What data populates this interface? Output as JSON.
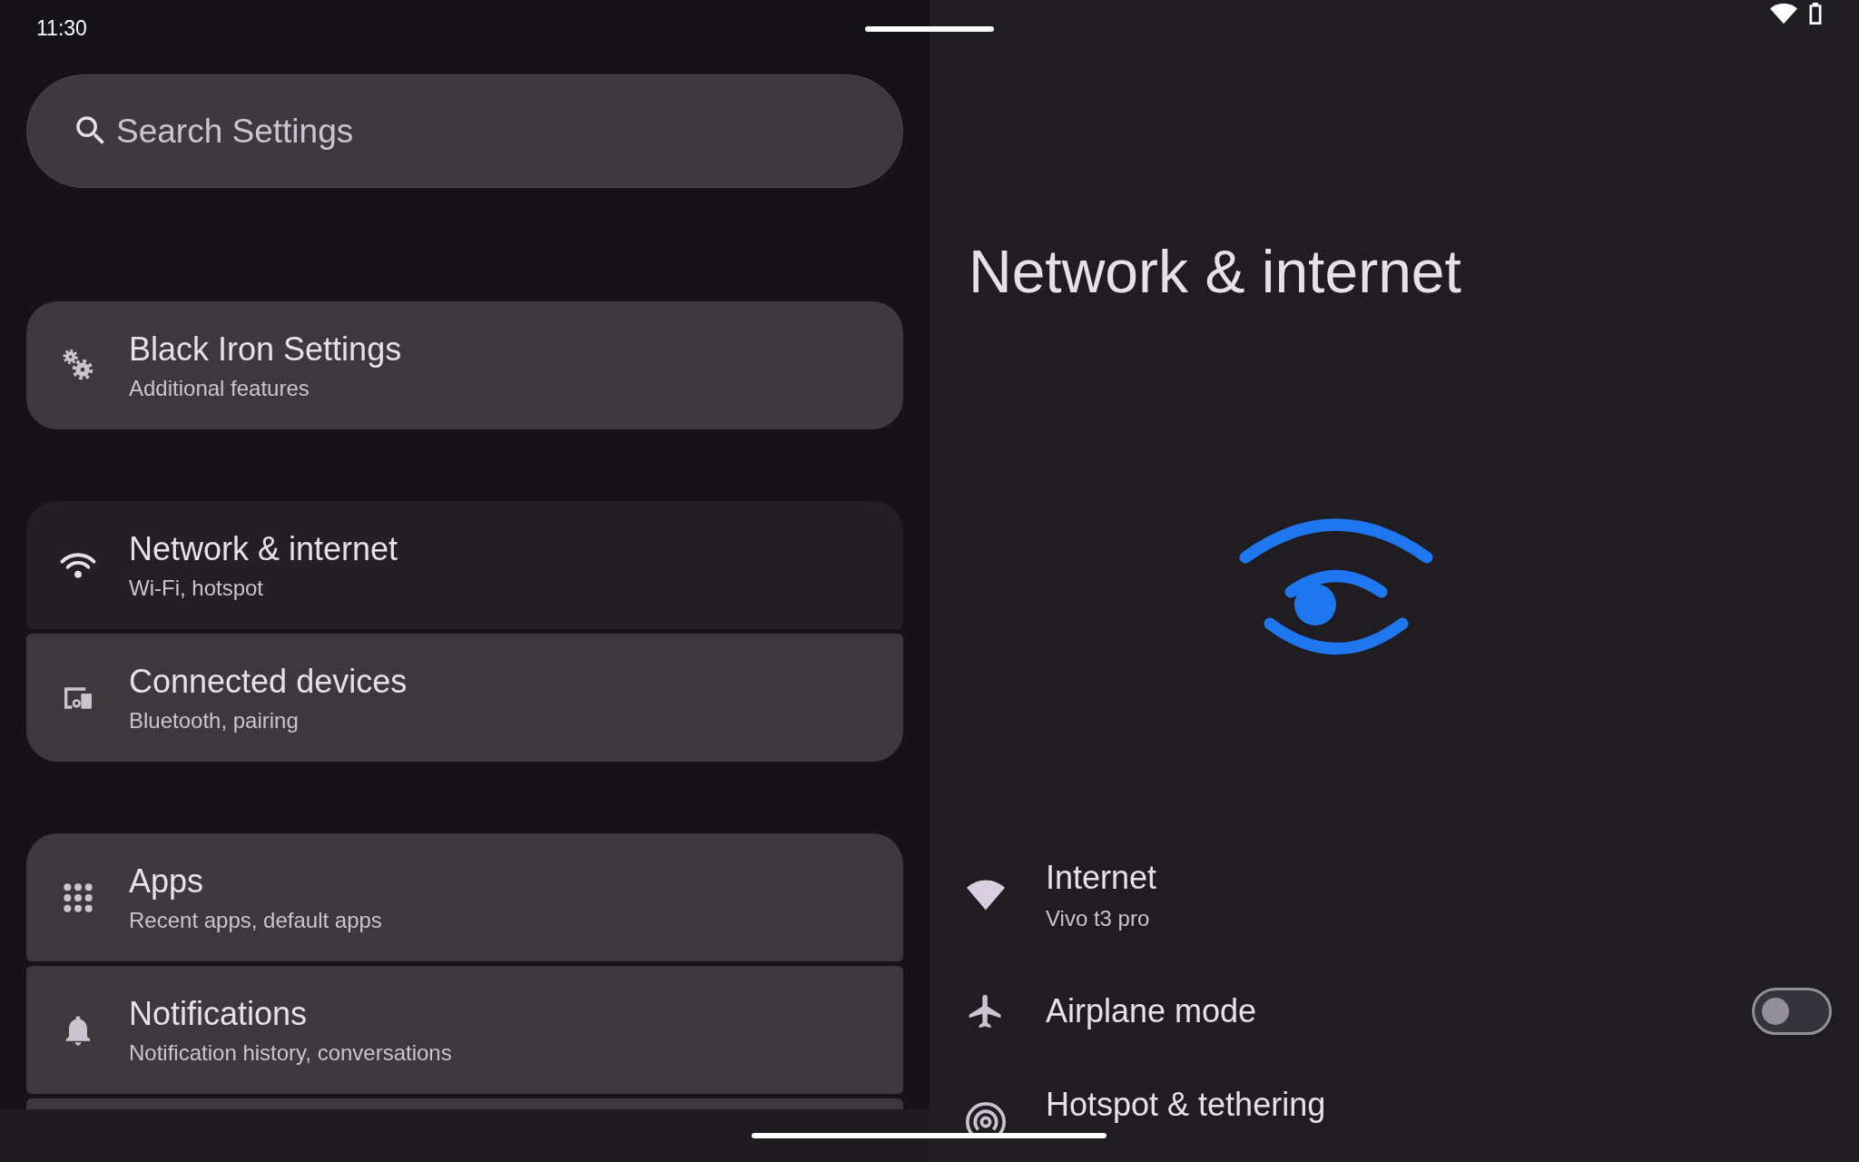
{
  "status_bar": {
    "time": "11:30"
  },
  "search": {
    "placeholder": "Search Settings"
  },
  "groups": [
    {
      "items": [
        {
          "title": "Black Iron Settings",
          "subtitle": "Additional features",
          "selected": false
        }
      ]
    },
    {
      "items": [
        {
          "title": "Network & internet",
          "subtitle": "Wi-Fi, hotspot",
          "selected": true
        },
        {
          "title": "Connected devices",
          "subtitle": "Bluetooth, pairing",
          "selected": false
        }
      ]
    },
    {
      "items": [
        {
          "title": "Apps",
          "subtitle": "Recent apps, default apps",
          "selected": false
        },
        {
          "title": "Notifications",
          "subtitle": "Notification history, conversations",
          "selected": false
        }
      ]
    }
  ],
  "detail": {
    "title": "Network & internet",
    "items": [
      {
        "kind": "link",
        "title": "Internet",
        "subtitle": "Vivo t3 pro"
      },
      {
        "kind": "toggle",
        "title": "Airplane mode",
        "on": false
      },
      {
        "kind": "link",
        "title": "Hotspot & tethering"
      }
    ]
  }
}
